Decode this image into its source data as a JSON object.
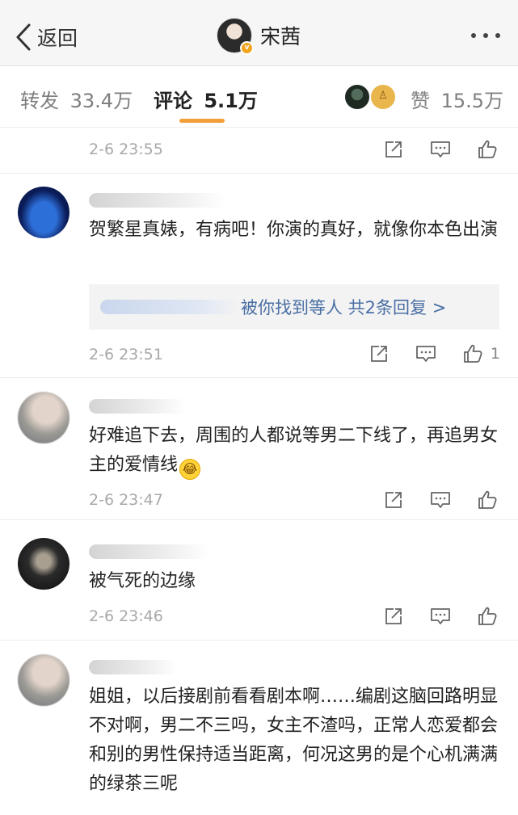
{
  "header": {
    "back_label": "返回",
    "title": "宋茜",
    "verified_badge": "v"
  },
  "tabs": {
    "repost_label": "转发",
    "repost_count": "33.4万",
    "comment_label": "评论",
    "comment_count": "5.1万",
    "like_label": "赞",
    "like_count": "15.5万"
  },
  "comments": [
    {
      "time": "2-6 23:55"
    },
    {
      "text": "贺繁星真婊，有病吧！你演的真好，就像你本色出演",
      "reply_link": "被你找到等人  共2条回复 >",
      "time": "2-6 23:51",
      "like_count": "1"
    },
    {
      "text": "好难追下去，周围的人都说等男二下线了，再追男女主的爱情线",
      "emoji": "😂",
      "time": "2-6 23:47"
    },
    {
      "text": "被气死的边缘",
      "time": "2-6 23:46"
    },
    {
      "text": "姐姐，以后接剧前看看剧本啊……编剧这脑回路明显不对啊，男二不三吗，女主不渣吗，正常人恋爱都会和别的男性保持适当距离，何况这男的是个心机满满的绿茶三呢"
    }
  ],
  "colors": {
    "accent_underline": "#f49e3a",
    "link_blue": "#4a6fa5",
    "muted_text": "#a8a8a8",
    "verified_orange": "#f2a41c"
  }
}
